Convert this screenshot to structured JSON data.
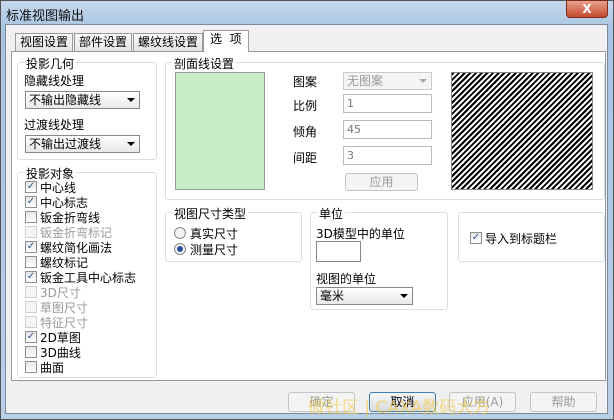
{
  "window": {
    "title": "标准视图输出",
    "close": "X"
  },
  "tabs": [
    "视图设置",
    "部件设置",
    "螺纹线设置",
    "选  项"
  ],
  "projection_geometry": {
    "title": "投影几何",
    "hidden_label": "隐藏线处理",
    "hidden_value": "不输出隐藏线",
    "transition_label": "过渡线处理",
    "transition_value": "不输出过渡线"
  },
  "projection_objects": {
    "title": "投影对象",
    "items": [
      {
        "label": "中心线",
        "checked": true,
        "enabled": true
      },
      {
        "label": "中心标志",
        "checked": true,
        "enabled": true
      },
      {
        "label": "钣金折弯线",
        "checked": false,
        "enabled": true
      },
      {
        "label": "钣金折弯标记",
        "checked": false,
        "enabled": false
      },
      {
        "label": "螺纹简化画法",
        "checked": true,
        "enabled": true
      },
      {
        "label": "螺纹标记",
        "checked": false,
        "enabled": true
      },
      {
        "label": "钣金工具中心标志",
        "checked": true,
        "enabled": true
      },
      {
        "label": "3D尺寸",
        "checked": false,
        "enabled": false
      },
      {
        "label": "草图尺寸",
        "checked": false,
        "enabled": false
      },
      {
        "label": "特征尺寸",
        "checked": false,
        "enabled": false
      },
      {
        "label": "2D草图",
        "checked": true,
        "enabled": true
      },
      {
        "label": "3D曲线",
        "checked": false,
        "enabled": true
      },
      {
        "label": "曲面",
        "checked": false,
        "enabled": true
      }
    ]
  },
  "hatch": {
    "title": "剖面线设置",
    "pattern_label": "图案",
    "pattern_value": "无图案",
    "scale_label": "比例",
    "scale_value": "1",
    "angle_label": "倾角",
    "angle_value": "45",
    "spacing_label": "间距",
    "spacing_value": "3",
    "apply": "应用",
    "preview_color": "#c8ecc8"
  },
  "dim_type": {
    "title": "视图尺寸类型",
    "options": [
      "真实尺寸",
      "测量尺寸"
    ],
    "selected": 1
  },
  "units": {
    "title": "单位",
    "model_label": "3D模型中的单位",
    "model_value": "",
    "view_label": "视图的单位",
    "view_value": "毫米"
  },
  "import": {
    "label": "导入到标题栏",
    "checked": true
  },
  "buttons": {
    "ok": "确定",
    "cancel": "取消",
    "apply": "应用(A)",
    "help": "帮助"
  },
  "watermark": "微社区 | CAXA数码大方"
}
